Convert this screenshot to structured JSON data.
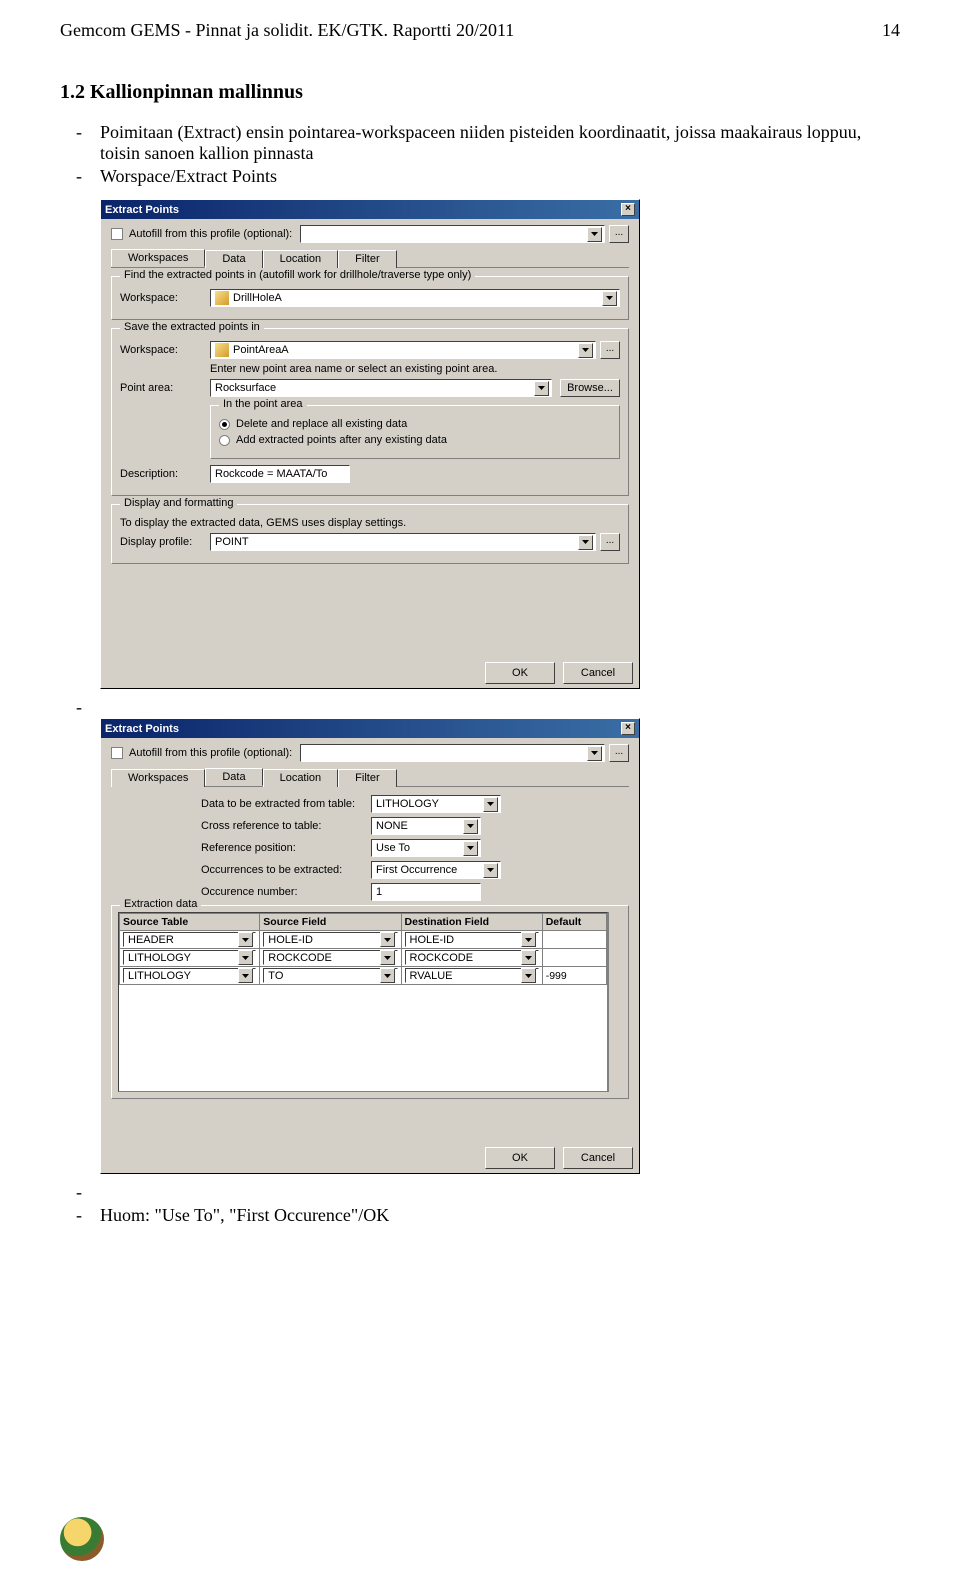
{
  "header": {
    "left": "Gemcom GEMS - Pinnat ja solidit. EK/GTK. Raportti 20/2011",
    "right": "14"
  },
  "section_title": "1.2 Kallionpinnan mallinnus",
  "body": {
    "b1": "Poimitaan (Extract) ensin pointarea-workspaceen niiden pisteiden koordinaatit, joissa maakairaus loppuu, toisin sanoen kallion pinnasta",
    "b2": "Worspace/Extract Points"
  },
  "d1": {
    "title": "Extract Points",
    "autofill_label": "Autofill from this profile (optional):",
    "tabs": {
      "t1": "Workspaces",
      "t2": "Data",
      "t3": "Location",
      "t4": "Filter"
    },
    "g1_title": "Find the extracted points in (autofill work for drillhole/traverse type only)",
    "g1_workspace_label": "Workspace:",
    "g1_workspace_value": "DrillHoleA",
    "g2_title": "Save the extracted points in",
    "g2_workspace_label": "Workspace:",
    "g2_workspace_value": "PointAreaA",
    "g2_hint": "Enter new point area name or select an existing point area.",
    "g2_pointarea_label": "Point area:",
    "g2_pointarea_value": "Rocksurface",
    "g2_browse": "Browse...",
    "g3_title": "In the point area",
    "g3_r1": "Delete and replace all existing data",
    "g3_r2": "Add extracted points after any existing data",
    "desc_label": "Description:",
    "desc_value": "Rockcode = MAATA/To",
    "g4_title": "Display and formatting",
    "g4_hint": "To display the extracted data, GEMS uses display settings.",
    "g4_profile_label": "Display profile:",
    "g4_profile_value": "POINT",
    "ok": "OK",
    "cancel": "Cancel"
  },
  "d2": {
    "title": "Extract Points",
    "autofill_label": "Autofill from this profile (optional):",
    "tabs": {
      "t1": "Workspaces",
      "t2": "Data",
      "t3": "Location",
      "t4": "Filter"
    },
    "f1_label": "Data to be extracted from table:",
    "f1_value": "LITHOLOGY",
    "f2_label": "Cross reference to table:",
    "f2_value": "NONE",
    "f3_label": "Reference position:",
    "f3_value": "Use To",
    "f4_label": "Occurrences to be extracted:",
    "f4_value": "First Occurrence",
    "f5_label": "Occurence number:",
    "f5_value": "1",
    "g_title": "Extraction data",
    "headers": {
      "h1": "Source Table",
      "h2": "Source Field",
      "h3": "Destination Field",
      "h4": "Default"
    },
    "rows": [
      {
        "st": "HEADER",
        "sf": "HOLE-ID",
        "df": "HOLE-ID",
        "def": ""
      },
      {
        "st": "LITHOLOGY",
        "sf": "ROCKCODE",
        "df": "ROCKCODE",
        "def": ""
      },
      {
        "st": "LITHOLOGY",
        "sf": "TO",
        "df": "RVALUE",
        "def": "-999"
      }
    ],
    "ok": "OK",
    "cancel": "Cancel"
  },
  "footnote": "Huom: \"Use To\", \"First Occurence\"/OK"
}
